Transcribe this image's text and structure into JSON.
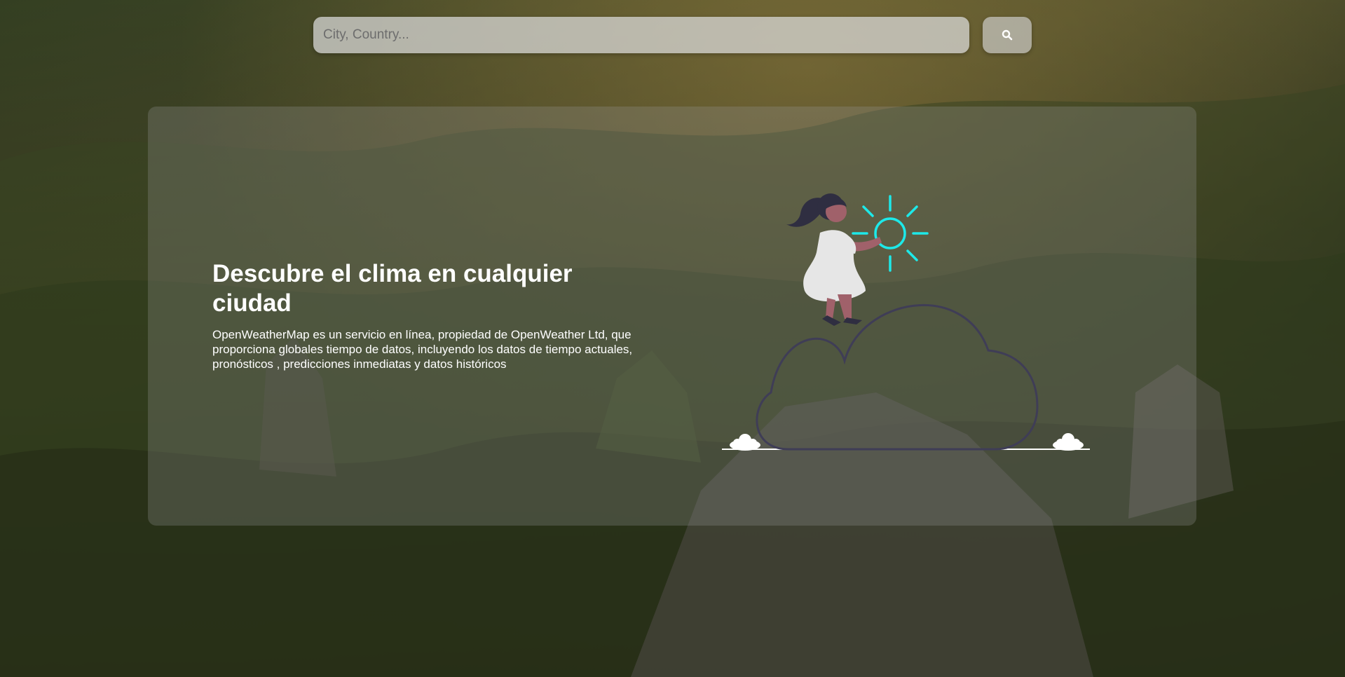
{
  "search": {
    "placeholder": "City, Country...",
    "value": "",
    "button_icon": "search-icon"
  },
  "hero": {
    "title": "Descubre el clima en cualquier ciudad",
    "description": "OpenWeatherMap es un servicio en línea, propiedad de OpenWeather Ltd, que proporciona globales tiempo de datos, incluyendo los datos de tiempo actuales, pronósticos , predicciones inmediatas y datos históricos"
  },
  "illustration": {
    "name": "woman-holding-sun-on-cloud",
    "sun_color": "#1de9e9",
    "cloud_outline_color": "#3f3d56"
  },
  "colors": {
    "text": "#ffffff",
    "card": "rgba(150,150,150,0.28)",
    "search_bg": "rgba(220,220,220,0.72)"
  }
}
